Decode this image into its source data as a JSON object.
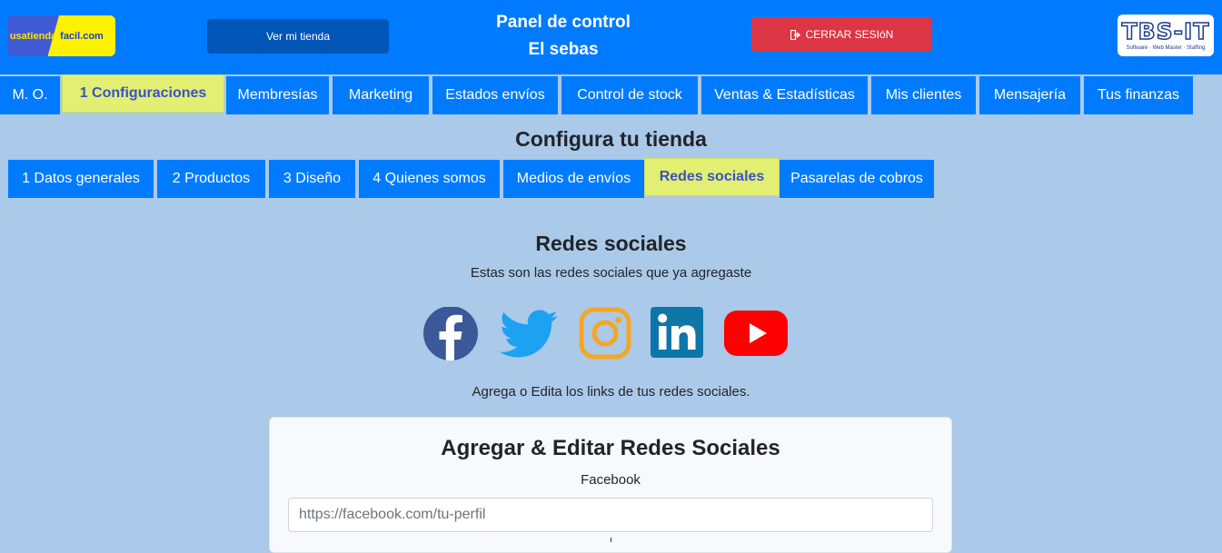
{
  "header": {
    "logo_left": {
      "part1": "usatienda",
      "part2": "facil.com"
    },
    "ver_tienda": "Ver mi tienda",
    "panel_title": "Panel de control",
    "store_name": "El sebas",
    "logout_label": "CERRAR SESIóN",
    "logo_right": {
      "brand": "TBS-IT",
      "tagline": "Software · Web Master · Staffing"
    }
  },
  "main_tabs": [
    "M. O.",
    "1 Configuraciones",
    "Membresías",
    "Marketing",
    "Estados envíos",
    "Control de stock",
    "Ventas & Estadísticas",
    "Mis clientes",
    "Mensajería",
    "Tus finanzas"
  ],
  "main_active": "1 Configuraciones",
  "config_title": "Configura tu tienda",
  "sub_tabs": [
    "1 Datos generales",
    "2 Productos",
    "3 Diseño",
    "4 Quienes somos",
    "Medios de envíos",
    "Redes sociales",
    "Pasarelas de cobros"
  ],
  "sub_active": "Redes sociales",
  "social": {
    "title": "Redes sociales",
    "subtitle": "Estas son las redes sociales que ya agregaste",
    "icons": [
      "facebook-icon",
      "twitter-icon",
      "instagram-icon",
      "linkedin-icon",
      "youtube-icon"
    ],
    "add_edit_text": "Agrega o Edita los links de tus redes sociales."
  },
  "card": {
    "title": "Agregar & Editar Redes Sociales",
    "field_label": "Facebook",
    "placeholder": "https://facebook.com/tu-perfil",
    "value": ""
  },
  "colors": {
    "page_bg": "#abc9e9",
    "primary": "#007bff",
    "active_tab": "#e2ef72",
    "logout": "#dc3545",
    "facebook": "#3b5998",
    "twitter": "#1da1f2",
    "instagram": "#f5a623",
    "linkedin": "#0e76a8",
    "youtube": "#ff0000"
  }
}
